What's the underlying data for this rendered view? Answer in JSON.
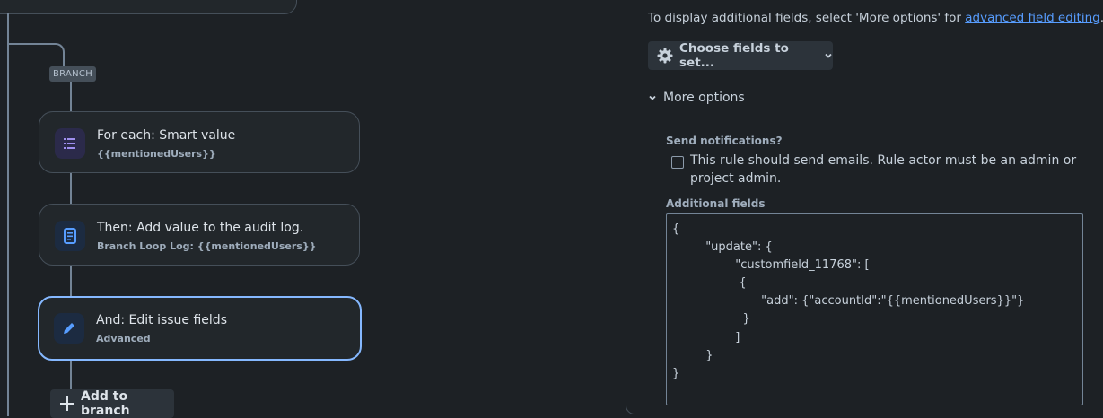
{
  "canvas": {
    "branch_tag": "BRANCH",
    "nodes": [
      {
        "title": "For each: Smart value",
        "subtitle": "{{mentionedUsers}}",
        "icon": "list-icon",
        "icon_bg": "#2b2a4a",
        "icon_color": "#9f8fef"
      },
      {
        "title": "Then: Add value to the audit log.",
        "subtitle": "Branch Loop Log: {{mentionedUsers}}",
        "icon": "document-icon",
        "icon_bg": "#1c2b41",
        "icon_color": "#579dff"
      },
      {
        "title": "And: Edit issue fields",
        "subtitle": "Advanced",
        "icon": "pencil-icon",
        "icon_bg": "#1c2b41",
        "icon_color": "#579dff"
      }
    ],
    "add_to_branch": "Add to branch"
  },
  "panel": {
    "info_prefix": "To display additional fields, select 'More options' for ",
    "info_link": "advanced field editing",
    "info_suffix": ".",
    "choose_fields": "Choose fields to set...",
    "more_options": "More options",
    "send_notifications_label": "Send notifications?",
    "send_notifications_text": "This rule should send emails. Rule actor must be an admin or project admin.",
    "send_notifications_checked": false,
    "additional_fields_label": "Additional fields",
    "additional_fields_value": "{\n         \"update\": {\n                 \"customfield_11768\": [\n                  {\n                        \"add\": {\"accountId\":\"{{mentionedUsers}}\"}\n                   }\n                 ]\n         }\n}"
  },
  "colors": {
    "background": "#1d2125",
    "accent": "#579dff",
    "selected_border": "#85b8ff"
  }
}
